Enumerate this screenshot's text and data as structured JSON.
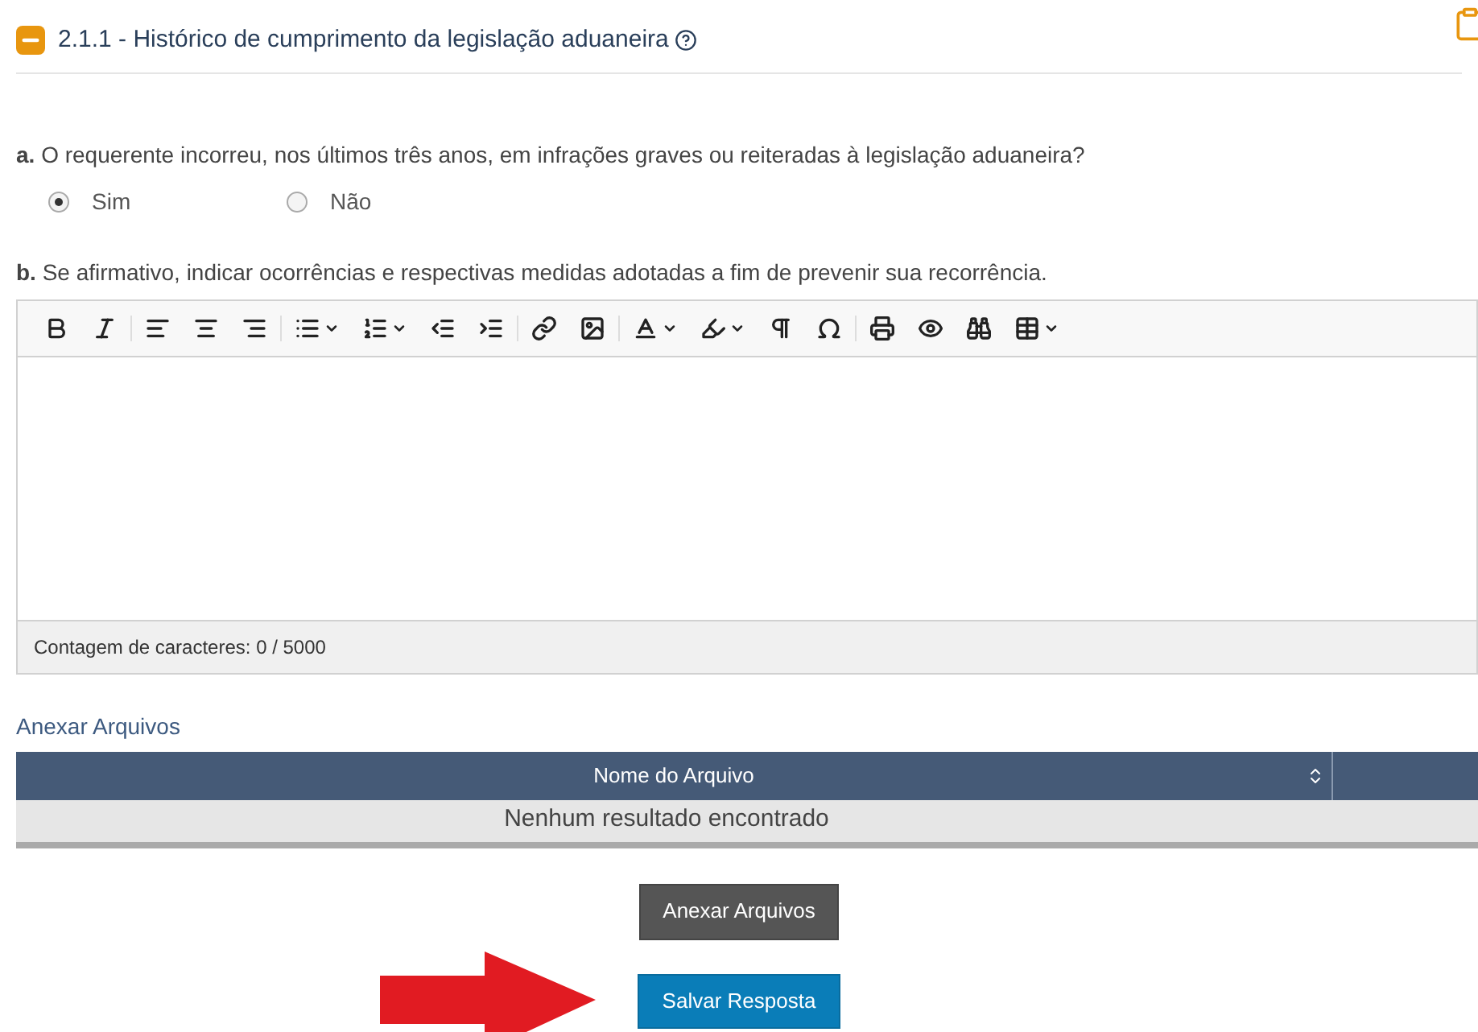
{
  "section": {
    "title": "2.1.1 - Histórico de cumprimento da legislação aduaneira"
  },
  "question_a": {
    "text": "**a.** O requerente incorreu, nos últimos três anos, em infrações graves ou reiteradas à legislação aduaneira?",
    "options": [
      {
        "label": "Sim",
        "selected": true
      },
      {
        "label": "Não",
        "selected": false
      }
    ]
  },
  "question_b": {
    "text": "**b.** Se afirmativo, indicar ocorrências e respectivas medidas adotadas a fim de prevenir sua recorrência.",
    "editor": {
      "char_count": "Contagem de caracteres: 0 / 5000"
    }
  },
  "attachments": {
    "label": "Anexar Arquivos",
    "columns": [
      "Nome do Arquivo"
    ],
    "empty_message": "Nenhum resultado encontrado"
  },
  "buttons": [
    "Anexar Arquivos",
    "Salvar Resposta"
  ]
}
